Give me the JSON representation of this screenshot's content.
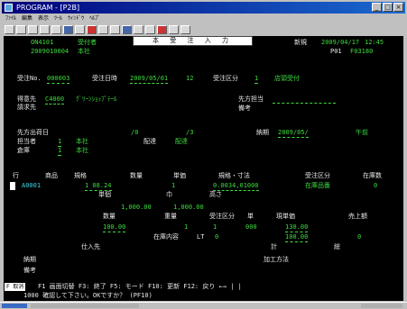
{
  "window": {
    "title": "PROGRAM - [P2B]"
  },
  "menu": [
    "ﾌｧｲﾙ",
    "編集",
    "表示",
    "ﾂｰﾙ",
    "ｳｨﾝﾄﾞｳ",
    "ﾍﾙﾌﾟ"
  ],
  "header": {
    "banner": "本 受 注 入 力 ",
    "line1_left": "ON4101",
    "line1_mid": "受付者",
    "line2_left": "2009010004",
    "line2_mid": "本社",
    "right_label": "新規",
    "right_date": "2009/04/17",
    "right_time": "12:45",
    "right_code": "P01",
    "right_code2": "F03180"
  },
  "order": {
    "no_label": "受注No.",
    "no_value": "000003",
    "date_label": "受注日時",
    "date_value": "2009/05/01",
    "date_suffix": "12",
    "type_label": "受注区分",
    "type_value": "1",
    "type_text": "店頭受付"
  },
  "customer": {
    "code_label": "得意先",
    "code_value": "C4000",
    "name_value": "ｸﾞﾘｰﾝｼｮｯﾌﾟﾃｰﾙ",
    "bill_label": "請求先",
    "to_label": "先方担当",
    "memo_label": "備考"
  },
  "ship": {
    "date_label": "先方出荷日",
    "date_v1": "/0",
    "date_v2": "/3",
    "deliv_label": "納期",
    "deliv_value": "2009/05/",
    "deliv_suffix": "午前",
    "wh_label": "担当者",
    "wh_value": "1",
    "wh_text": "本社",
    "delv_type": "配達",
    "delv_type2": "配達",
    "store_label": "倉庫",
    "store_value": "1",
    "store_text": "本社"
  },
  "grid": {
    "h_row": "行",
    "h_code": "商品",
    "h_size": "規格",
    "h_qty": "数量",
    "h_unit": "単価",
    "h_spec": "規格・寸法",
    "h_type": "受注区分",
    "h_stock": "在庫数",
    "r1_code": "A0001",
    "r1_q1": "1 08.24",
    "r1_q2": "1",
    "r1_spec": "0.0034,01000",
    "r1_type": "在庫品番",
    "r1_end": "0",
    "r1_b1": "単個",
    "r1_b2": "巾",
    "r1_b3": "高さ",
    "r2_v1": "1,000.00",
    "r2_v2": "1,000.00",
    "r2_l1": "数量",
    "r2_l2": "重量",
    "r2_l3": "受注区分",
    "r2_l4": "単",
    "r2_l5": "現単価",
    "r2_l6": "売上額",
    "r3_v1": "100.00",
    "r3_v2": "1",
    "r3_v3": "1",
    "r3_v4": "000",
    "r3_v5": "130.00",
    "r4_l1": "在庫内容",
    "r4_l2": "LT",
    "r4_l3": "0",
    "r4_v1": "100.00",
    "r4_v2": "0",
    "r5_l1": "仕入先",
    "r5_l2": "計",
    "r5_l3": "総",
    "r6_l1": "納期",
    "r6_l2": "加工方法",
    "r7_l1": "備考"
  },
  "footer": {
    "badge": "F 取消",
    "keys": "F1 画面切替 F3: 終了 F5: モード F10: 更新 F12: 戻り ←→ | |",
    "prompt": "1000 確認して下さい。OKですか？ (PF10)"
  }
}
